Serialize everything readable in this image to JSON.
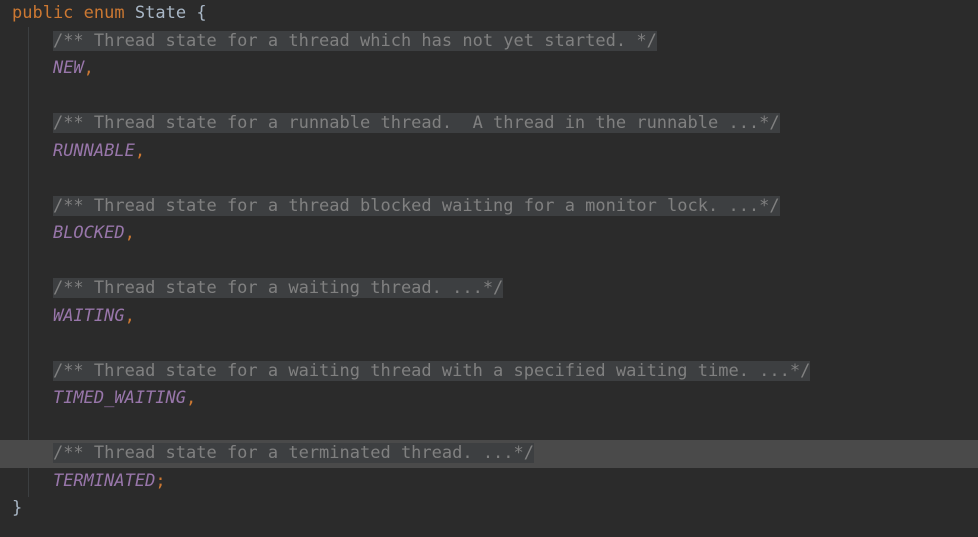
{
  "editor": {
    "language": "java",
    "theme": "darcula",
    "colors": {
      "background": "#2b2b2b",
      "keyword": "#cc7832",
      "identifier": "#a9b7c6",
      "enum_constant": "#9876aa",
      "comment_folded": "#808080",
      "fold_background": "#3d3f41",
      "current_line_background": "#4a4a4a",
      "indent_guide": "#3c3f41"
    }
  },
  "code": {
    "lines": [
      {
        "id": "line-declaration",
        "indent": 0,
        "current": false,
        "tokens": [
          {
            "type": "keyword",
            "text": "public"
          },
          {
            "type": "plain",
            "text": " "
          },
          {
            "type": "keyword",
            "text": "enum"
          },
          {
            "type": "plain",
            "text": " "
          },
          {
            "type": "type",
            "text": "State"
          },
          {
            "type": "plain",
            "text": " "
          },
          {
            "type": "brace",
            "text": "{"
          }
        ]
      },
      {
        "id": "line-comment-new",
        "indent": 1,
        "current": false,
        "tokens": [
          {
            "type": "fold",
            "text": "/** Thread state for a thread which has not yet started. */"
          }
        ]
      },
      {
        "id": "line-const-new",
        "indent": 1,
        "current": false,
        "tokens": [
          {
            "type": "enum_constant",
            "text": "NEW"
          },
          {
            "type": "punctuation",
            "text": ","
          }
        ]
      },
      {
        "id": "line-blank-1",
        "indent": 0,
        "current": false,
        "tokens": []
      },
      {
        "id": "line-comment-runnable",
        "indent": 1,
        "current": false,
        "tokens": [
          {
            "type": "fold",
            "text": "/** Thread state for a runnable thread.  A thread in the runnable ...*/"
          }
        ]
      },
      {
        "id": "line-const-runnable",
        "indent": 1,
        "current": false,
        "tokens": [
          {
            "type": "enum_constant",
            "text": "RUNNABLE"
          },
          {
            "type": "punctuation",
            "text": ","
          }
        ]
      },
      {
        "id": "line-blank-2",
        "indent": 0,
        "current": false,
        "tokens": []
      },
      {
        "id": "line-comment-blocked",
        "indent": 1,
        "current": false,
        "tokens": [
          {
            "type": "fold",
            "text": "/** Thread state for a thread blocked waiting for a monitor lock. ...*/"
          }
        ]
      },
      {
        "id": "line-const-blocked",
        "indent": 1,
        "current": false,
        "tokens": [
          {
            "type": "enum_constant",
            "text": "BLOCKED"
          },
          {
            "type": "punctuation",
            "text": ","
          }
        ]
      },
      {
        "id": "line-blank-3",
        "indent": 0,
        "current": false,
        "tokens": []
      },
      {
        "id": "line-comment-waiting",
        "indent": 1,
        "current": false,
        "tokens": [
          {
            "type": "fold",
            "text": "/** Thread state for a waiting thread. ...*/"
          }
        ]
      },
      {
        "id": "line-const-waiting",
        "indent": 1,
        "current": false,
        "tokens": [
          {
            "type": "enum_constant",
            "text": "WAITING"
          },
          {
            "type": "punctuation",
            "text": ","
          }
        ]
      },
      {
        "id": "line-blank-4",
        "indent": 0,
        "current": false,
        "tokens": []
      },
      {
        "id": "line-comment-timed-waiting",
        "indent": 1,
        "current": false,
        "tokens": [
          {
            "type": "fold",
            "text": "/** Thread state for a waiting thread with a specified waiting time. ...*/"
          }
        ]
      },
      {
        "id": "line-const-timed-waiting",
        "indent": 1,
        "current": false,
        "tokens": [
          {
            "type": "enum_constant",
            "text": "TIMED_WAITING"
          },
          {
            "type": "punctuation",
            "text": ","
          }
        ]
      },
      {
        "id": "line-blank-5",
        "indent": 0,
        "current": false,
        "tokens": []
      },
      {
        "id": "line-comment-terminated",
        "indent": 1,
        "current": true,
        "tokens": [
          {
            "type": "fold",
            "text": "/** Thread state for a terminated thread. ...*/"
          }
        ]
      },
      {
        "id": "line-const-terminated",
        "indent": 1,
        "current": false,
        "tokens": [
          {
            "type": "enum_constant",
            "text": "TERMINATED"
          },
          {
            "type": "punctuation",
            "text": ";"
          }
        ]
      },
      {
        "id": "line-close-brace",
        "indent": 0,
        "current": false,
        "tokens": [
          {
            "type": "brace",
            "text": "}"
          }
        ]
      }
    ]
  }
}
